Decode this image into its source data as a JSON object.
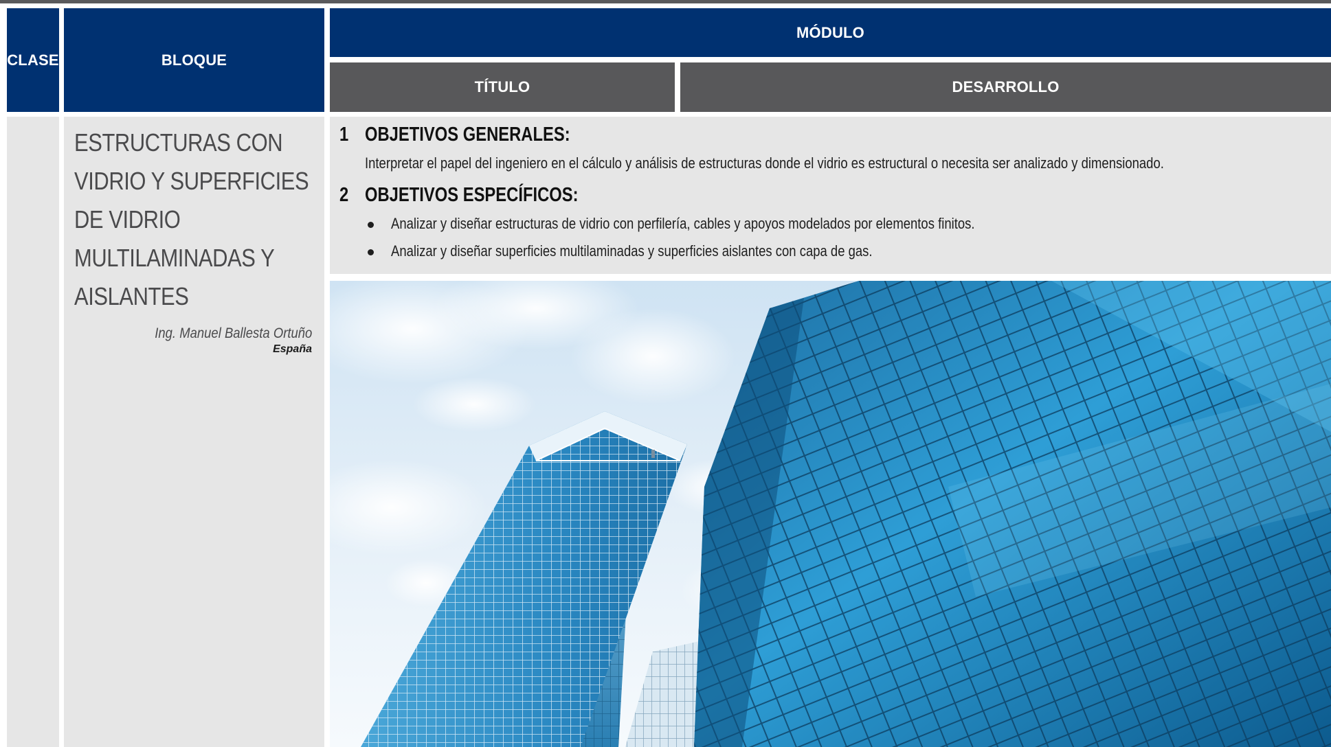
{
  "header": {
    "clase": "CLASE",
    "bloque": "BLOQUE",
    "modulo": "MÓDULO",
    "titulo": "TÍTULO",
    "desarrollo": "DESARROLLO"
  },
  "block": {
    "title_lines": [
      "ESTRUCTURAS CON",
      "VIDRIO Y SUPERFICIES",
      "DE VIDRIO",
      "MULTILAMINADAS Y",
      "AISLANTES"
    ],
    "author": "Ing. Manuel Ballesta Ortuño",
    "country": "España"
  },
  "content": {
    "sections": [
      {
        "number": "1",
        "title": "OBJETIVOS GENERALES:",
        "text": "Interpretar el papel del ingeniero en el cálculo y análisis de estructuras donde el vidrio es estructural o necesita ser analizado y dimensionado."
      },
      {
        "number": "2",
        "title": "OBJETIVOS ESPECÍFICOS:",
        "bullets": [
          "Analizar y diseñar estructuras de vidrio con perfilería, cables y apoyos modelados por elementos finitos.",
          "Analizar y diseñar superficies multilaminadas y superficies aislantes con capa de gas."
        ]
      }
    ]
  },
  "colors": {
    "header_blue": "#003171",
    "subheader_gray": "#58585a",
    "cell_gray": "#e6e6e6"
  },
  "image": {
    "subject": "glass skyscrapers against blue sky"
  }
}
